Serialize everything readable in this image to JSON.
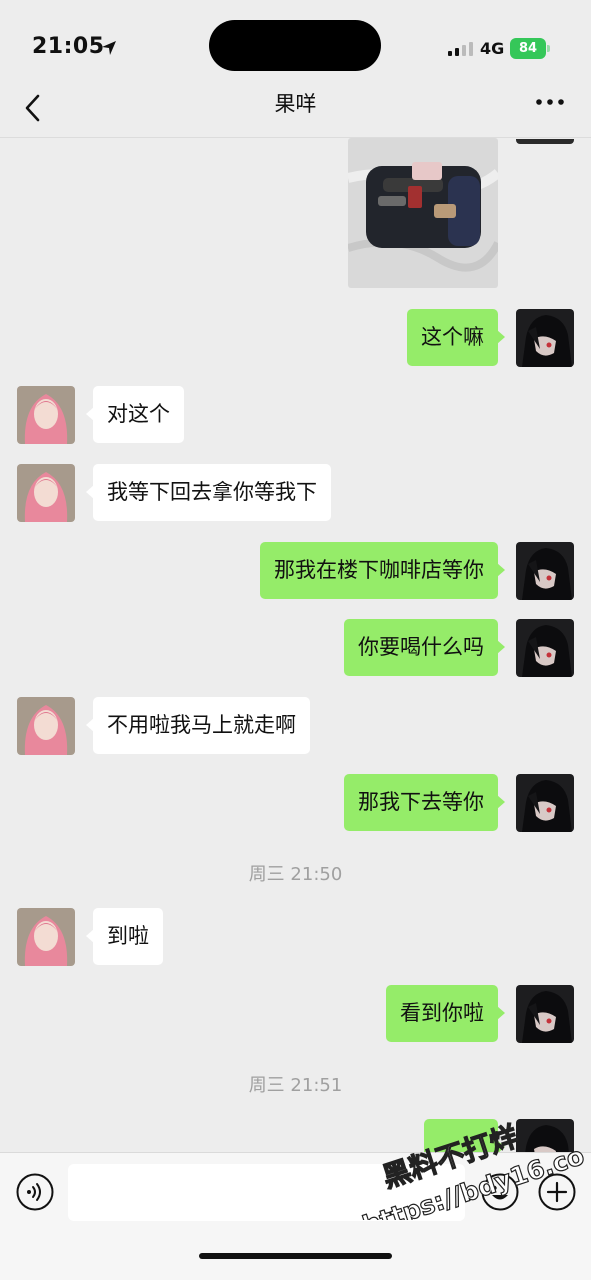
{
  "status_bar": {
    "time": "21:05",
    "network": "4G",
    "battery": "84"
  },
  "nav": {
    "title": "果咩"
  },
  "messages": {
    "m1": "这个嘛",
    "m2": "对这个",
    "m3": "我等下回去拿你等我下",
    "m4": "那我在楼下咖啡店等你",
    "m5": "你要喝什么吗",
    "m6": "不用啦我马上就走啊",
    "m7": "那我下去等你",
    "ts1": "周三 21:50",
    "m8": "到啦",
    "m9": "看到你啦",
    "ts2": "周三 21:51"
  },
  "watermark": {
    "line1": "黑料不打烊",
    "line2": "https://bdy16.co"
  },
  "colors": {
    "sent_bubble": "#95ec69",
    "received_bubble": "#ffffff",
    "background": "#ededed"
  }
}
